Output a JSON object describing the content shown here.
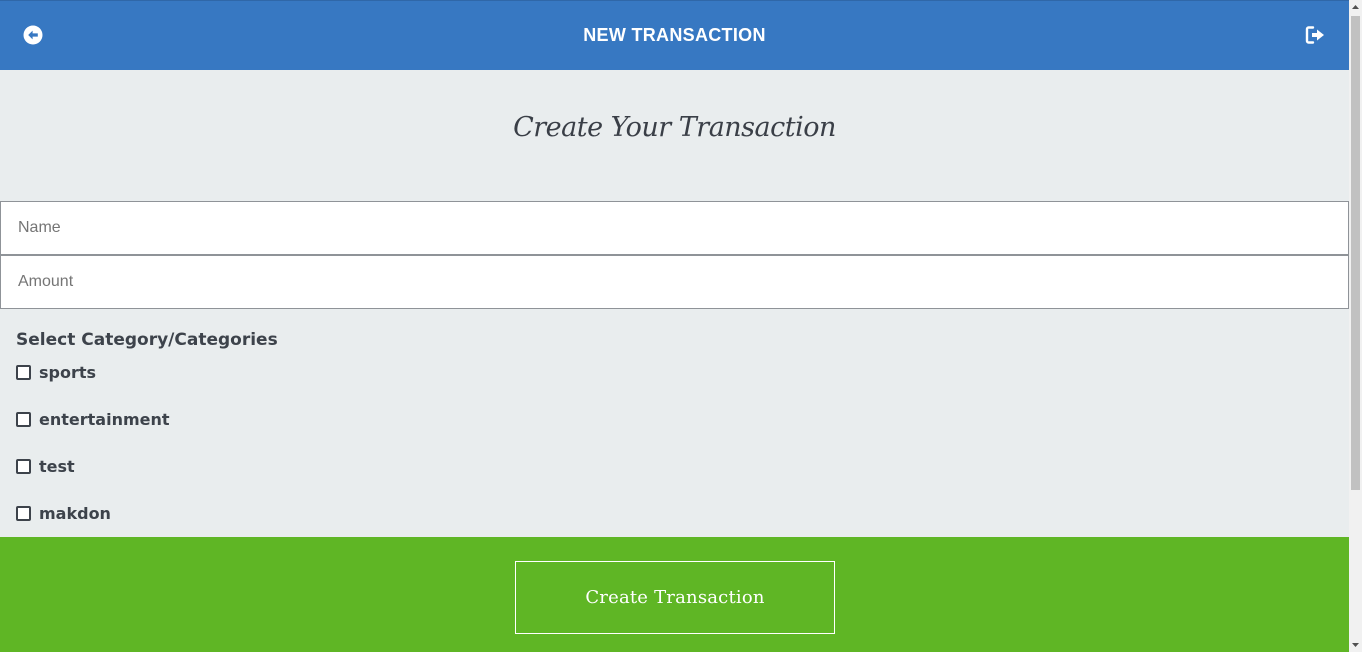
{
  "header": {
    "title": "NEW TRANSACTION",
    "back_icon": "arrow-circle-left-icon",
    "logout_icon": "sign-out-icon",
    "background_color": "#3778c2"
  },
  "main": {
    "heading": "Create Your Transaction",
    "name_field": {
      "placeholder": "Name",
      "value": ""
    },
    "amount_field": {
      "placeholder": "Amount",
      "value": ""
    },
    "category_label": "Select Category/Categories",
    "categories": [
      {
        "label": "sports",
        "checked": false
      },
      {
        "label": "entertainment",
        "checked": false
      },
      {
        "label": "test",
        "checked": false
      },
      {
        "label": "makdon",
        "checked": false
      }
    ]
  },
  "footer": {
    "button_label": "Create Transaction",
    "background_color": "#5fb625"
  }
}
